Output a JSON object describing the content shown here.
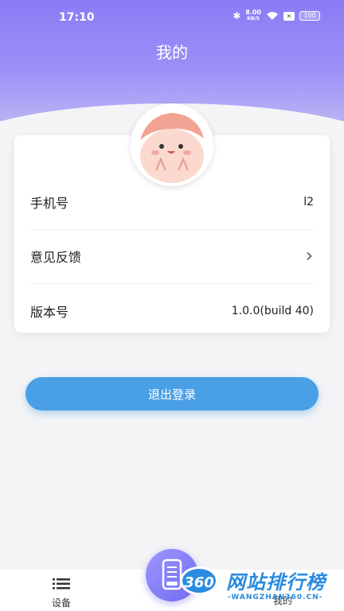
{
  "status_bar": {
    "time": "17:10",
    "speed_value": "8.00",
    "speed_unit": "KB/S",
    "battery": "100"
  },
  "header": {
    "title": "我的"
  },
  "profile": {
    "rows": [
      {
        "label": "手机号",
        "value": "l2"
      },
      {
        "label": "意见反馈",
        "value": ""
      },
      {
        "label": "版本号",
        "value": "1.0.0(build 40)"
      }
    ]
  },
  "actions": {
    "logout_label": "退出登录"
  },
  "tabbar": {
    "devices_label": "设备",
    "mine_label": "我的"
  },
  "watermark": {
    "badge": "360",
    "title": "网站排行榜",
    "subtitle": "-WANGZHAN360.CN-"
  },
  "colors": {
    "header_gradient_top": "#8a7cf6",
    "accent_button": "#4aa0e6",
    "fab": "#7d78f2",
    "page_bg": "#f4f4f6"
  }
}
